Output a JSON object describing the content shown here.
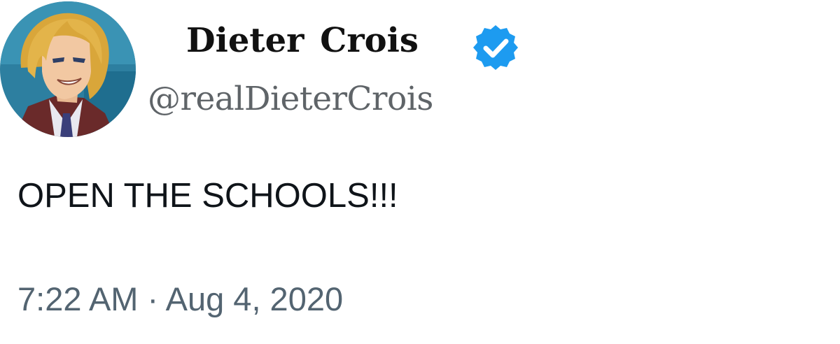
{
  "author": {
    "display_name": "Dieter  Crois",
    "handle": "@realDieterCrois",
    "verified": true,
    "verified_color": "#1d9bf0",
    "avatar_icon": "anime-character-portrait"
  },
  "tweet": {
    "text": "OPEN THE SCHOOLS!!!",
    "timestamp": "7:22 AM · Aug 4, 2020"
  }
}
